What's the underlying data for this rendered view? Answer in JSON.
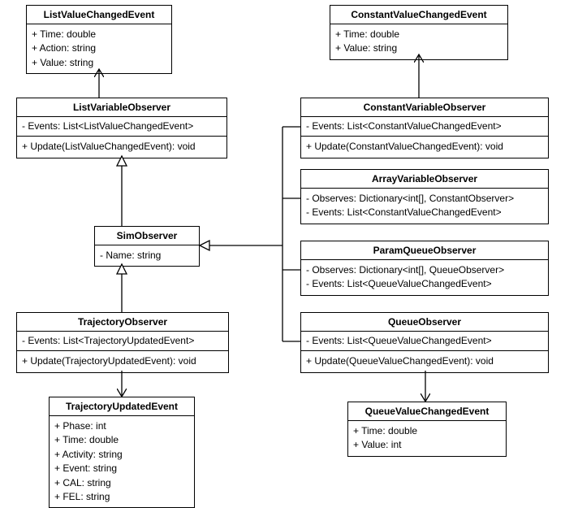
{
  "classes": {
    "ListValueChangedEvent": {
      "name": "ListValueChangedEvent",
      "attrs": [
        "+ Time: double",
        "+ Action: string",
        "+ Value: string"
      ]
    },
    "ListVariableObserver": {
      "name": "ListVariableObserver",
      "attrs": [
        "- Events: List<ListValueChangedEvent>"
      ],
      "ops": [
        "+ Update(ListValueChangedEvent): void"
      ]
    },
    "SimObserver": {
      "name": "SimObserver",
      "attrs": [
        "- Name: string"
      ]
    },
    "TrajectoryObserver": {
      "name": "TrajectoryObserver",
      "attrs": [
        "- Events: List<TrajectoryUpdatedEvent>"
      ],
      "ops": [
        "+ Update(TrajectoryUpdatedEvent): void"
      ]
    },
    "TrajectoryUpdatedEvent": {
      "name": "TrajectoryUpdatedEvent",
      "attrs": [
        "+ Phase: int",
        "+ Time: double",
        "+ Activity: string",
        "+ Event: string",
        "+ CAL: string",
        "+ FEL: string"
      ]
    },
    "ConstantValueChangedEvent": {
      "name": "ConstantValueChangedEvent",
      "attrs": [
        "+ Time: double",
        "+ Value: string"
      ]
    },
    "ConstantVariableObserver": {
      "name": "ConstantVariableObserver",
      "attrs": [
        "- Events: List<ConstantValueChangedEvent>"
      ],
      "ops": [
        "+ Update(ConstantValueChangedEvent): void"
      ]
    },
    "ArrayVariableObserver": {
      "name": "ArrayVariableObserver",
      "attrs": [
        "- Observes: Dictionary<int[], ConstantObserver>",
        "- Events: List<ConstantValueChangedEvent>"
      ]
    },
    "ParamQueueObserver": {
      "name": "ParamQueueObserver",
      "attrs": [
        "- Observes: Dictionary<int[], QueueObserver>",
        "- Events: List<QueueValueChangedEvent>"
      ]
    },
    "QueueObserver": {
      "name": "QueueObserver",
      "attrs": [
        "- Events: List<QueueValueChangedEvent>"
      ],
      "ops": [
        "+ Update(QueueValueChangedEvent): void"
      ]
    },
    "QueueValueChangedEvent": {
      "name": "QueueValueChangedEvent",
      "attrs": [
        "+ Time: double",
        "+ Value: int"
      ]
    }
  },
  "connectors": [
    {
      "from": "ListVariableObserver",
      "to": "ListValueChangedEvent",
      "type": "dependency"
    },
    {
      "from": "ConstantVariableObserver",
      "to": "ConstantValueChangedEvent",
      "type": "dependency"
    },
    {
      "from": "QueueObserver",
      "to": "QueueValueChangedEvent",
      "type": "dependency"
    },
    {
      "from": "TrajectoryObserver",
      "to": "TrajectoryUpdatedEvent",
      "type": "dependency"
    },
    {
      "from": "ListVariableObserver",
      "to": "SimObserver",
      "type": "inheritance"
    },
    {
      "from": "TrajectoryObserver",
      "to": "SimObserver",
      "type": "inheritance"
    },
    {
      "from": "ConstantVariableObserver",
      "to": "SimObserver",
      "type": "inheritance"
    },
    {
      "from": "ArrayVariableObserver",
      "to": "SimObserver",
      "type": "inheritance"
    },
    {
      "from": "ParamQueueObserver",
      "to": "SimObserver",
      "type": "inheritance"
    },
    {
      "from": "QueueObserver",
      "to": "SimObserver",
      "type": "inheritance"
    }
  ]
}
